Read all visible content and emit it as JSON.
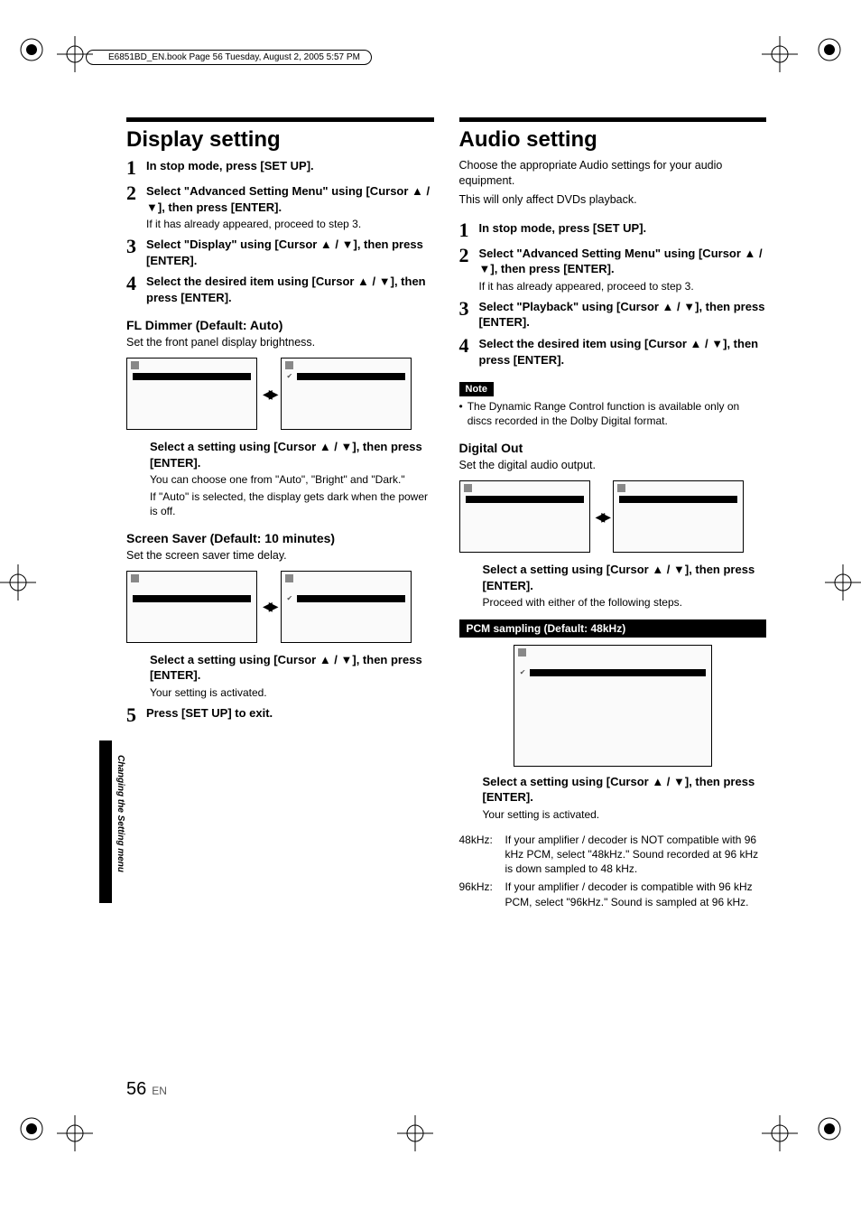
{
  "meta": {
    "print_header": "E6851BD_EN.book  Page 56  Tuesday, August 2, 2005  5:57 PM"
  },
  "left": {
    "title": "Display setting",
    "steps": [
      {
        "num": "1",
        "title": "In stop mode, press [SET UP]."
      },
      {
        "num": "2",
        "title": "Select \"Advanced Setting Menu\" using [Cursor ▲ / ▼], then press [ENTER].",
        "sub": "If it has already appeared, proceed to step 3."
      },
      {
        "num": "3",
        "title": "Select \"Display\" using [Cursor ▲ / ▼], then press [ENTER]."
      },
      {
        "num": "4",
        "title": "Select the desired item using [Cursor ▲ / ▼], then press [ENTER]."
      }
    ],
    "fl_dimmer": {
      "heading": "FL Dimmer (Default: Auto)",
      "desc": "Set the front panel display brightness.",
      "instr": "Select a setting using [Cursor ▲ / ▼], then press [ENTER].",
      "sub1": "You can choose one from \"Auto\", \"Bright\" and \"Dark.\"",
      "sub2": "If \"Auto\" is selected, the display gets dark when the power is off."
    },
    "screen_saver": {
      "heading": "Screen Saver (Default: 10 minutes)",
      "desc": "Set the screen saver time delay.",
      "instr": "Select a setting using [Cursor ▲ / ▼], then press [ENTER].",
      "sub": "Your setting is activated."
    },
    "step5": {
      "num": "5",
      "title": "Press [SET UP] to exit."
    }
  },
  "right": {
    "title": "Audio setting",
    "intro1": "Choose the appropriate Audio settings for your audio equipment.",
    "intro2": "This will only affect DVDs playback.",
    "steps": [
      {
        "num": "1",
        "title": "In stop mode, press [SET UP]."
      },
      {
        "num": "2",
        "title": "Select \"Advanced Setting Menu\" using [Cursor ▲ / ▼], then press [ENTER].",
        "sub": "If it has already appeared, proceed to step 3."
      },
      {
        "num": "3",
        "title": "Select \"Playback\" using [Cursor ▲ / ▼], then press [ENTER]."
      },
      {
        "num": "4",
        "title": "Select the desired item using [Cursor ▲ / ▼], then press [ENTER]."
      }
    ],
    "note_label": "Note",
    "note_text": "The Dynamic Range Control function is available only on discs recorded in the Dolby Digital format.",
    "digital_out": {
      "heading": "Digital Out",
      "desc": "Set the digital audio output.",
      "instr": "Select a setting using [Cursor ▲ / ▼], then press [ENTER].",
      "sub": "Proceed with either of the following steps."
    },
    "pcm": {
      "bar": "PCM sampling (Default: 48kHz)",
      "instr": "Select a setting using [Cursor ▲ / ▼], then press [ENTER].",
      "sub": "Your setting is activated.",
      "defs": [
        {
          "key": "48kHz:",
          "val": "If your amplifier / decoder is NOT compatible with 96 kHz PCM, select \"48kHz.\" Sound recorded at 96 kHz is down sampled to 48 kHz."
        },
        {
          "key": "96kHz:",
          "val": "If your amplifier / decoder is compatible with 96 kHz PCM, select \"96kHz.\" Sound is sampled at 96 kHz."
        }
      ]
    }
  },
  "footer": {
    "tab": "Changing the Setting menu",
    "page": "56",
    "lang": "EN"
  }
}
